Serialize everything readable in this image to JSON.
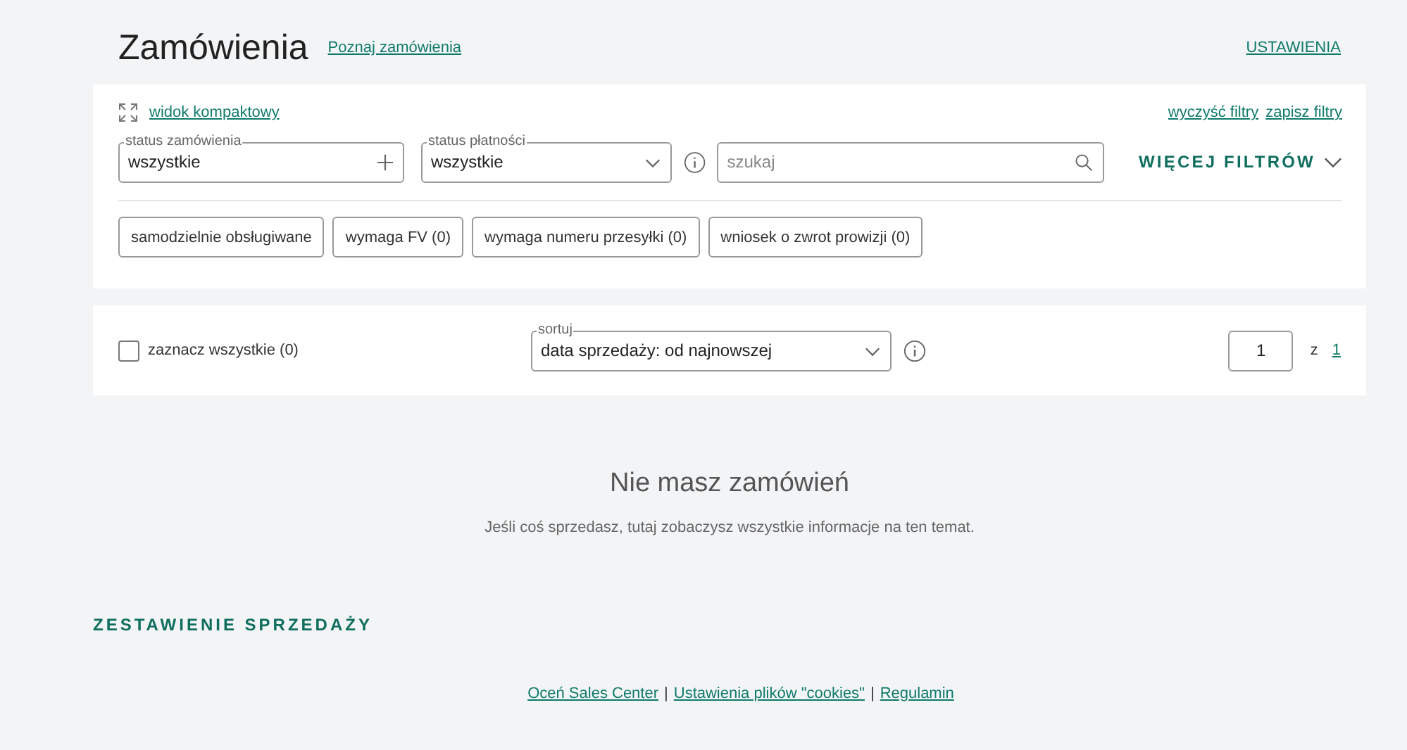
{
  "header": {
    "title": "Zamówienia",
    "learn_link": "Poznaj zamówienia",
    "settings_link": "USTAWIENIA"
  },
  "filters": {
    "compact_view": "widok kompaktowy",
    "clear_link": "wyczyść filtry",
    "save_link": "zapisz filtry",
    "order_status": {
      "label": "status zamówienia",
      "value": "wszystkie"
    },
    "payment_status": {
      "label": "status płatności",
      "value": "wszystkie"
    },
    "search": {
      "placeholder": "szukaj"
    },
    "more_filters": "WIĘCEJ FILTRÓW",
    "chips": [
      {
        "label": "samodzielnie obsługiwane",
        "selected": false
      },
      {
        "label": "wymaga FV (0)",
        "selected": false
      },
      {
        "label": "wymaga numeru przesyłki (0)",
        "selected": false
      },
      {
        "label": "wniosek o zwrot prowizji (0)",
        "selected": false
      }
    ]
  },
  "list_bar": {
    "select_all": {
      "label": "zaznacz wszystkie (0)",
      "checked": false
    },
    "sort": {
      "label": "sortuj",
      "value": "data sprzedaży: od najnowszej"
    },
    "page": {
      "value": "1",
      "of": "z",
      "total": "1"
    }
  },
  "empty": {
    "title": "Nie masz zamówień",
    "text": "Jeśli coś sprzedasz, tutaj zobaczysz wszystkie informacje na ten temat."
  },
  "sales_summary": "ZESTAWIENIE SPRZEDAŻY",
  "footer": {
    "links": [
      "Oceń Sales Center",
      "Ustawienia plików \"cookies\"",
      "Regulamin"
    ],
    "separator": "|"
  }
}
